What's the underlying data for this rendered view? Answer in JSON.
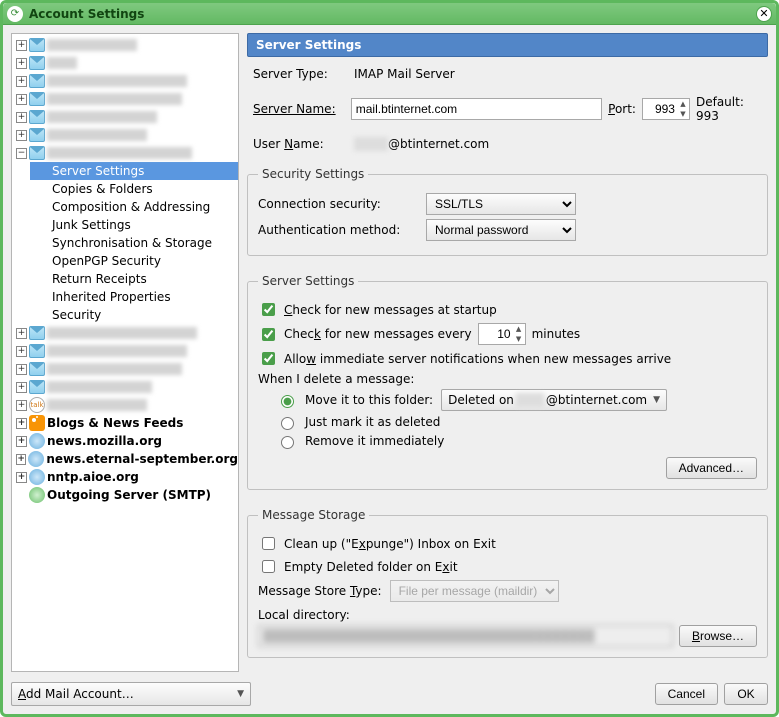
{
  "window": {
    "title": "Account Settings"
  },
  "header": {
    "title": "Server Settings"
  },
  "tree": {
    "selected": "Server Settings",
    "children": [
      "Server Settings",
      "Copies & Folders",
      "Composition & Addressing",
      "Junk Settings",
      "Synchronisation & Storage",
      "OpenPGP Security",
      "Return Receipts",
      "Inherited Properties",
      "Security"
    ],
    "blogs": "Blogs & News Feeds",
    "news1": "news.mozilla.org",
    "news2": "news.eternal-september.org",
    "news3": "nntp.aioe.org",
    "smtp": "Outgoing Server (SMTP)"
  },
  "serverType": {
    "label": "Server Type:",
    "value": "IMAP Mail Server"
  },
  "serverName": {
    "label": "Server Name:",
    "value": "mail.btinternet.com"
  },
  "port": {
    "label": "Port:",
    "value": "993",
    "default": "Default: 993"
  },
  "userName": {
    "label": "User Name:",
    "suffix": "@btinternet.com"
  },
  "sec": {
    "legend": "Security Settings",
    "conn": {
      "label": "Connection security:",
      "value": "SSL/TLS"
    },
    "auth": {
      "label": "Authentication method:",
      "value": "Normal password"
    }
  },
  "srv": {
    "legend": "Server Settings",
    "chk1_a": "C",
    "chk1_b": "heck for new messages at startup",
    "chk2_a": "Chec",
    "chk2_b": "k for new messages every",
    "interval": "10",
    "minutes": "minutes",
    "chk3_a": "Allo",
    "chk3_b": "w immediate server notifications when new messages arrive",
    "whenDel": "When I delete a message:",
    "r1": "Move it to this folder:",
    "r1_sel_a": "Deleted on ",
    "r1_sel_b": "@btinternet.com",
    "r2": "Just mark it as deleted",
    "r3": "Remove it immediately",
    "advanced": "Advanced…"
  },
  "store": {
    "legend": "Message Storage",
    "c1_a": "Clean up (\"E",
    "c1_b": "xpunge\") Inbox on Exit",
    "c2_a": "Empty Deleted folder on E",
    "c2_b": "xit",
    "typeL": "Message Store Type:",
    "typeV": "File per message (maildir)",
    "localL": "Local directory:",
    "browse": "Browse…"
  },
  "footer": {
    "add_a": "A",
    "add_b": "dd Mail Account…",
    "cancel": "Cancel",
    "ok": "OK"
  }
}
